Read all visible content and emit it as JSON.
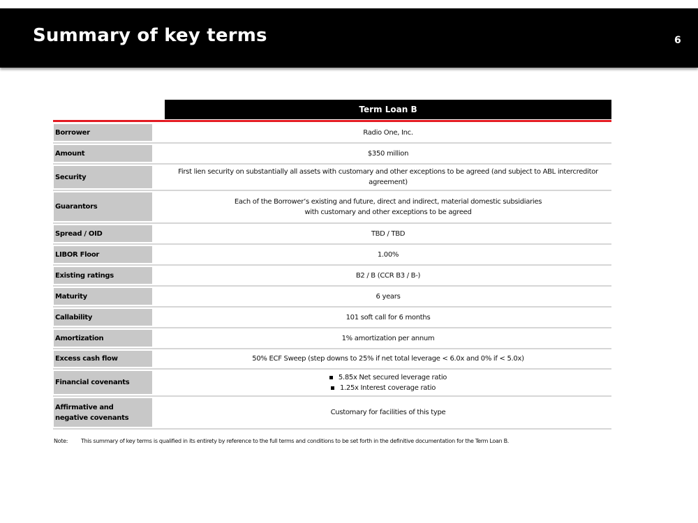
{
  "header": {
    "title": "Summary of key terms",
    "page_number": "6"
  },
  "table": {
    "column_header": "Term Loan B",
    "rows": [
      {
        "label": "Borrower",
        "value": "Radio One, Inc."
      },
      {
        "label": "Amount",
        "value": "$350 million"
      },
      {
        "label": "Security",
        "value": "First lien security on substantially all assets with customary and other exceptions to be agreed (and subject to ABL intercreditor agreement)"
      },
      {
        "label": "Guarantors",
        "value_lines": [
          "Each of the Borrower’s existing and future, direct and indirect, material domestic subsidiaries",
          "with customary and other exceptions to be agreed"
        ]
      },
      {
        "label": "Spread / OID",
        "value": "TBD / TBD"
      },
      {
        "label": "LIBOR Floor",
        "value": "1.00%"
      },
      {
        "label": "Existing ratings",
        "value": "B2 / B (CCR B3 / B-)"
      },
      {
        "label": "Maturity",
        "value": "6 years"
      },
      {
        "label": "Callability",
        "value": "101 soft call for 6 months"
      },
      {
        "label": "Amortization",
        "value": "1% amortization per annum"
      },
      {
        "label": "Excess cash flow",
        "value": "50% ECF Sweep (step downs to 25% if net total leverage < 6.0x and 0% if < 5.0x)"
      },
      {
        "label": "Financial covenants",
        "bullets": [
          "5.85x Net secured leverage ratio",
          "1.25x Interest coverage ratio"
        ]
      },
      {
        "label": "Affirmative and negative covenants",
        "value": "Customary for facilities of this type"
      }
    ]
  },
  "note": {
    "label": "Note:",
    "text": "This summary of key terms is qualified in its entirety by reference to the full terms and conditions to be set forth in the definitive documentation for the Term Loan B."
  },
  "colors": {
    "header_bg": "#000000",
    "accent_red": "#e31b23",
    "label_bg": "#c8c8c8",
    "row_divider": "#d6d6d6"
  }
}
